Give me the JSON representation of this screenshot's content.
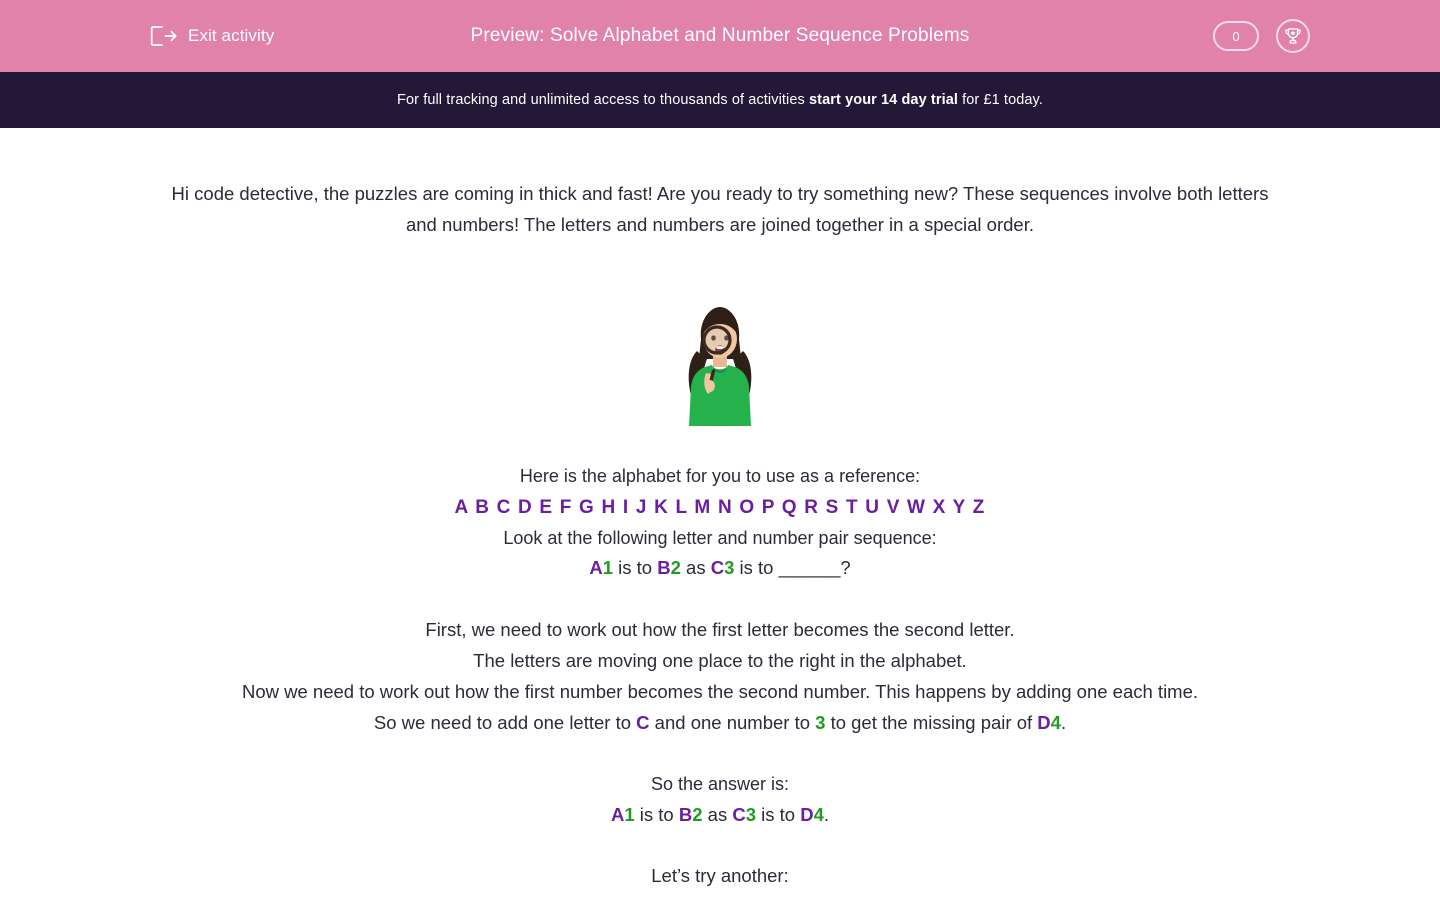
{
  "topbar": {
    "exit_label": "Exit activity",
    "exit_icon": "exit-door-arrow-icon",
    "title": "Preview: Solve Alphabet and Number Sequence Problems",
    "score": "0",
    "trophy_icon": "trophy-icon",
    "bg_color": "#E182AA"
  },
  "promo": {
    "text_before": "For full tracking and unlimited access to thousands of activities ",
    "text_bold": "start your 14 day trial",
    "text_after": " for £1 today.",
    "bg_color": "#231838"
  },
  "main": {
    "intro": "Hi code detective, the puzzles are coming in thick and fast!  Are you ready to try something new? These sequences involve both letters and numbers! The letters and numbers are joined together in a special order.",
    "figure_alt": "girl-with-magnifying-glass-photo",
    "alphabet_heading": "Here is the alphabet for you to use as a reference:",
    "alphabet": "A B C D E F G H I J K L M N O P Q R S T U V W X Y Z",
    "sequence_heading": "Look at the following letter and number pair sequence:",
    "question": {
      "p1_letter": "A",
      "p1_num": "1",
      "is_to_1": " is to ",
      "p2_letter": "B",
      "p2_num": "2",
      "as": " as ",
      "p3_letter": "C",
      "p3_num": "3",
      "is_to_2": " is to ",
      "blank": "______",
      "qmark": "?"
    },
    "explain_line1": "First, we need to work out how the first letter becomes the second letter.",
    "explain_line2": "The letters are moving one place to the right in the alphabet.",
    "explain_line3": "Now we need to work out how the first number becomes the second number. This happens by adding one each time.",
    "explain_line4": {
      "a": "So we need to add one letter to ",
      "letter": "C",
      "b": " and one number to ",
      "num": "3",
      "c": " to get the missing pair of ",
      "ans_letter": "D",
      "ans_num": "4",
      "d": "."
    },
    "answer_heading": "So the answer is:",
    "answer": {
      "p1_letter": "A",
      "p1_num": "1",
      "is_to_1": " is to ",
      "p2_letter": "B",
      "p2_num": "2",
      "as": " as ",
      "p3_letter": "C",
      "p3_num": "3",
      "is_to_2": " is to ",
      "p4_letter": "D",
      "p4_num": "4",
      "period": "."
    },
    "lets_try": "Let’s try another:",
    "letter_color": "#6B1FA0",
    "number_color": "#1F9D1F"
  }
}
